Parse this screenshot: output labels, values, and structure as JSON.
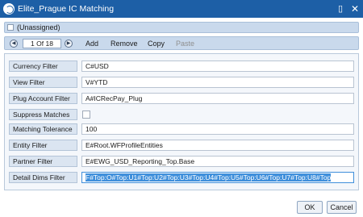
{
  "window": {
    "title": "Elite_Prague  IC Matching",
    "restore_glyph": "▯",
    "close_glyph": "✕"
  },
  "unassigned": {
    "label": "(Unassigned)",
    "checked": false
  },
  "toolbar": {
    "prev_glyph": "◀",
    "page": "1 Of 18",
    "next_glyph": "▶",
    "add_label": "Add",
    "remove_label": "Remove",
    "copy_label": "Copy",
    "paste_label": "Paste"
  },
  "form": {
    "currency_filter": {
      "label": "Currency Filter",
      "value": "C#USD"
    },
    "view_filter": {
      "label": "View Filter",
      "value": "V#YTD"
    },
    "plug_account_filter": {
      "label": "Plug Account Filter",
      "value": "A#ICRecPay_Plug"
    },
    "suppress_matches": {
      "label": "Suppress Matches",
      "checked": false
    },
    "matching_tolerance": {
      "label": "Matching Tolerance",
      "value": "100"
    },
    "entity_filter": {
      "label": "Entity Filter",
      "value": "E#Root.WFProfileEntities"
    },
    "partner_filter": {
      "label": "Partner Filter",
      "value": "E#EWG_USD_Reporting_Top.Base"
    },
    "detail_dims_filter": {
      "label": "Detail Dims Filter",
      "value": "F#Top:O#Top:U1#Top:U2#Top:U3#Top:U4#Top:U5#Top:U6#Top:U7#Top:U8#Top"
    }
  },
  "footer": {
    "ok_label": "OK",
    "cancel_label": "Cancel"
  },
  "colors": {
    "titlebar": "#1d5fa6",
    "toolbar": "#c9d9ec",
    "label_bg": "#dbe5f1",
    "selection": "#3f8fdb"
  }
}
